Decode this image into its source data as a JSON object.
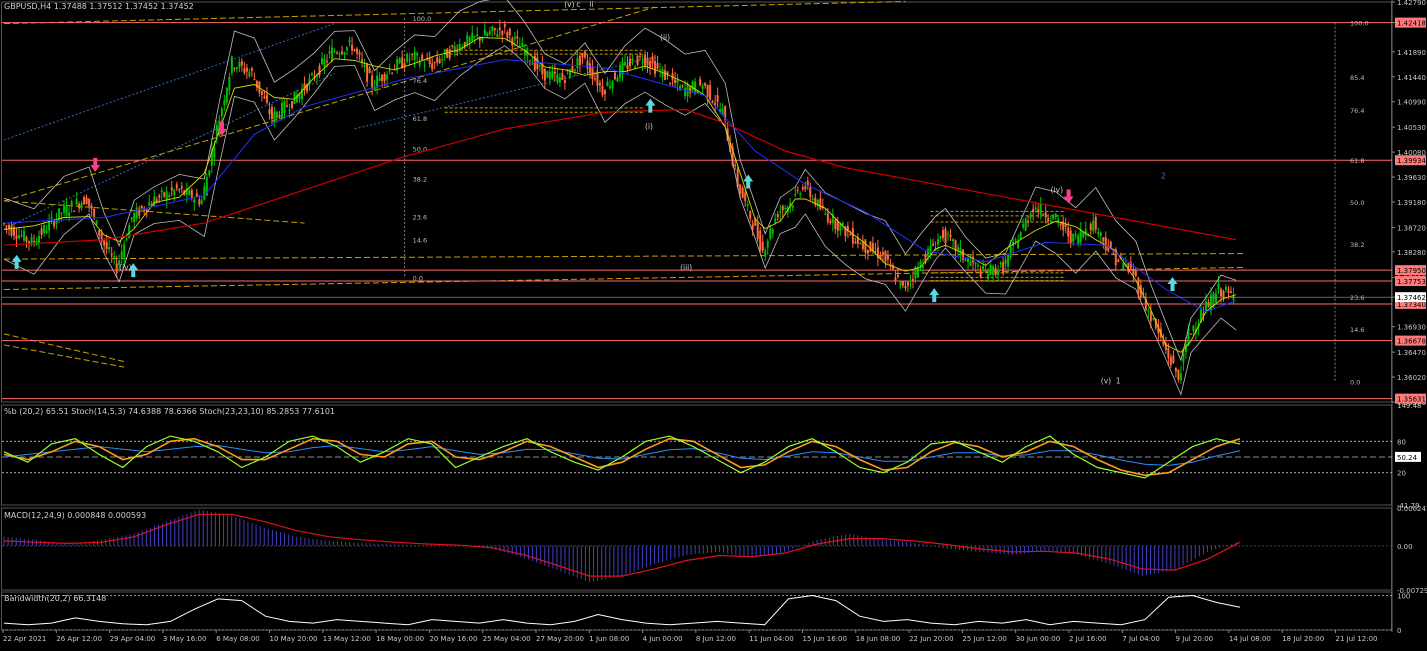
{
  "header": {
    "main": "GBPUSD,H4  1.37488 1.37512 1.37452 1.37452",
    "stoch": "%b (20,2) 65.51  Stoch(14,5,3) 74.6388 78.6366  Stoch(23,23,10) 85.2853 77.6101",
    "macd": "MACD(12,24,9) 0.000848 0.000593",
    "bandwidth": "Bandwidth(20,2) 66.3148"
  },
  "colors": {
    "background": "#000000",
    "bull_candle": "#00c000",
    "bear_candle": "#ff6a3c",
    "resistance_line": "#ff6b6b",
    "fib_dashed": "#c8a000",
    "ma_200": "#d00000",
    "ma_blue": "#2030ff",
    "ma_yellow": "#d8d800",
    "bollinger": "#c0c0c0",
    "stoch_main": "#9aff2a",
    "stoch_signal": "#ff9a1a",
    "stoch_slow": "#2a8cff",
    "macd_hist": "#4040c0",
    "macd_signal": "#e01020",
    "bandwidth": "#ffffff",
    "price_tag": "#ff7a7a",
    "bid_tag": "#ffffff",
    "up_arrow": "#5ad8e0",
    "down_arrow": "#ff3d8b"
  },
  "chart_data": {
    "type": "candlestick",
    "symbol": "GBPUSD",
    "timeframe": "H4",
    "ohlc_header": {
      "open": 1.37488,
      "high": 1.37512,
      "low": 1.37452,
      "close": 1.37452
    },
    "ylim": [
      1.3557,
      1.4279
    ],
    "price_ticks": [
      "1.42790",
      "1.42418",
      "1.41890",
      "1.41440",
      "1.40990",
      "1.40530",
      "1.40080",
      "1.39630",
      "1.39180",
      "1.38720",
      "1.38280",
      "1.37820",
      "1.37462",
      "1.36930",
      "1.36470",
      "1.36020",
      "1.35570"
    ],
    "price_ticks_values": [
      1.4279,
      1.42418,
      1.4189,
      1.4144,
      1.4099,
      1.4053,
      1.4008,
      1.3963,
      1.3918,
      1.3872,
      1.3828,
      1.3782,
      1.37462,
      1.3693,
      1.3647,
      1.3602,
      1.3557
    ],
    "price_tags": [
      {
        "label": "1.42418",
        "value": 1.42418
      },
      {
        "label": "1.39934",
        "value": 1.39934
      },
      {
        "label": "1.37950",
        "value": 1.3795
      },
      {
        "label": "1.37753",
        "value": 1.37753
      },
      {
        "label": "1.37340",
        "value": 1.3734
      },
      {
        "label": "1.36678",
        "value": 1.36678
      },
      {
        "label": "1.35631",
        "value": 1.35631
      }
    ],
    "bid_tag": {
      "label": "1.37462",
      "value": 1.37462
    },
    "resistance_lines": [
      1.42418,
      1.39934,
      1.3795,
      1.37753,
      1.3734,
      1.36678,
      1.35631
    ],
    "fib_right": [
      {
        "label": "100.0",
        "value": 1.42418
      },
      {
        "label": "85.4",
        "value": 1.4144
      },
      {
        "label": "76.4",
        "value": 1.4084
      },
      {
        "label": "61.8",
        "value": 1.39934
      },
      {
        "label": "50.0",
        "value": 1.3918
      },
      {
        "label": "38.2",
        "value": 1.3842
      },
      {
        "label": "23.6",
        "value": 1.37462
      },
      {
        "label": "14.6",
        "value": 1.3689
      },
      {
        "label": "0.0",
        "value": 1.3594
      }
    ],
    "fib_left": [
      {
        "label": "100.0",
        "value": 1.425
      },
      {
        "label": "76.4",
        "value": 1.4138
      },
      {
        "label": "61.8",
        "value": 1.407
      },
      {
        "label": "50.0",
        "value": 1.4015
      },
      {
        "label": "38.2",
        "value": 1.396
      },
      {
        "label": "23.6",
        "value": 1.3892
      },
      {
        "label": "14.6",
        "value": 1.385
      },
      {
        "label": "0.0",
        "value": 1.3782
      }
    ],
    "wave_labels": [
      {
        "text": "(v)",
        "x": 1.5
      },
      {
        "text": "c",
        "x": 1.62
      },
      {
        "text": "ii",
        "x": 1.75
      },
      {
        "text": "(ii)",
        "x": 3.3
      },
      {
        "text": "(i)",
        "x": 1.6
      },
      {
        "text": "(iii)",
        "x": 5.5
      },
      {
        "text": "(iv)",
        "x": 0.85
      },
      {
        "text": "(iv)",
        "x": 8.6
      },
      {
        "text": "(v)",
        "x": 9.8
      },
      {
        "text": "1",
        "x": 9.95
      },
      {
        "text": "2",
        "x": 11.55
      }
    ],
    "x_labels": [
      "22 Apr 2021",
      "26 Apr 12:00",
      "29 Apr 04:00",
      "3 May 16:00",
      "6 May 08:00",
      "10 May 20:00",
      "13 May 12:00",
      "18 May 00:00",
      "20 May 16:00",
      "25 May 04:00",
      "27 May 20:00",
      "1 Jun 08:00",
      "4 Jun 00:00",
      "8 Jun 12:00",
      "11 Jun 04:00",
      "15 Jun 16:00",
      "18 Jun 08:00",
      "22 Jun 20:00",
      "25 Jun 12:00",
      "30 Jun 00:00",
      "2 Jul 16:00",
      "7 Jul 04:00",
      "9 Jul 20:00",
      "14 Jul 08:00",
      "18 Jul 20:00",
      "21 Jul 12:00"
    ],
    "close_path": [
      [
        0,
        1.388
      ],
      [
        0.3,
        1.3845
      ],
      [
        0.6,
        1.39
      ],
      [
        0.85,
        1.3925
      ],
      [
        1.0,
        1.385
      ],
      [
        1.15,
        1.38
      ],
      [
        1.3,
        1.389
      ],
      [
        1.5,
        1.392
      ],
      [
        1.75,
        1.394
      ],
      [
        2.0,
        1.392
      ],
      [
        2.15,
        1.405
      ],
      [
        2.3,
        1.417
      ],
      [
        2.5,
        1.415
      ],
      [
        2.7,
        1.407
      ],
      [
        2.9,
        1.41
      ],
      [
        3.1,
        1.414
      ],
      [
        3.3,
        1.419
      ],
      [
        3.5,
        1.42
      ],
      [
        3.7,
        1.413
      ],
      [
        3.9,
        1.416
      ],
      [
        4.1,
        1.418
      ],
      [
        4.3,
        1.4165
      ],
      [
        4.55,
        1.42
      ],
      [
        4.75,
        1.4215
      ],
      [
        5.0,
        1.423
      ],
      [
        5.2,
        1.4195
      ],
      [
        5.4,
        1.415
      ],
      [
        5.6,
        1.414
      ],
      [
        5.8,
        1.418
      ],
      [
        6.0,
        1.412
      ],
      [
        6.2,
        1.416
      ],
      [
        6.4,
        1.418
      ],
      [
        6.6,
        1.415
      ],
      [
        6.8,
        1.412
      ],
      [
        7.0,
        1.413
      ],
      [
        7.2,
        1.408
      ],
      [
        7.35,
        1.395
      ],
      [
        7.5,
        1.388
      ],
      [
        7.6,
        1.383
      ],
      [
        7.75,
        1.39
      ],
      [
        7.9,
        1.392
      ],
      [
        8.0,
        1.395
      ],
      [
        8.2,
        1.39
      ],
      [
        8.4,
        1.387
      ],
      [
        8.6,
        1.384
      ],
      [
        8.8,
        1.382
      ],
      [
        9.0,
        1.376
      ],
      [
        9.15,
        1.38
      ],
      [
        9.3,
        1.384
      ],
      [
        9.4,
        1.386
      ],
      [
        9.6,
        1.382
      ],
      [
        9.8,
        1.379
      ],
      [
        10.0,
        1.38
      ],
      [
        10.3,
        1.391
      ],
      [
        10.5,
        1.389
      ],
      [
        10.7,
        1.385
      ],
      [
        10.9,
        1.388
      ],
      [
        11.1,
        1.382
      ],
      [
        11.3,
        1.379
      ],
      [
        11.45,
        1.372
      ],
      [
        11.6,
        1.366
      ],
      [
        11.75,
        1.36
      ],
      [
        11.85,
        1.368
      ],
      [
        12.0,
        1.372
      ],
      [
        12.15,
        1.376
      ],
      [
        12.3,
        1.3746
      ]
    ],
    "ma200_path": [
      [
        0,
        1.384
      ],
      [
        1.0,
        1.385
      ],
      [
        2.0,
        1.388
      ],
      [
        3.0,
        1.394
      ],
      [
        4.0,
        1.4
      ],
      [
        5.0,
        1.405
      ],
      [
        6.0,
        1.408
      ],
      [
        6.8,
        1.4085
      ],
      [
        7.2,
        1.406
      ],
      [
        7.8,
        1.401
      ],
      [
        8.4,
        1.398
      ],
      [
        9.0,
        1.396
      ],
      [
        9.6,
        1.394
      ],
      [
        10.2,
        1.392
      ],
      [
        10.8,
        1.39
      ],
      [
        11.4,
        1.388
      ],
      [
        12.3,
        1.385
      ]
    ],
    "ma_blue_path": [
      [
        0,
        1.388
      ],
      [
        1.0,
        1.389
      ],
      [
        2.0,
        1.393
      ],
      [
        2.5,
        1.404
      ],
      [
        3.0,
        1.409
      ],
      [
        4.0,
        1.414
      ],
      [
        5.0,
        1.4175
      ],
      [
        6.0,
        1.416
      ],
      [
        7.0,
        1.411
      ],
      [
        7.5,
        1.401
      ],
      [
        8.0,
        1.395
      ],
      [
        8.6,
        1.39
      ],
      [
        9.2,
        1.383
      ],
      [
        9.8,
        1.381
      ],
      [
        10.4,
        1.3845
      ],
      [
        11.0,
        1.384
      ],
      [
        11.6,
        1.376
      ],
      [
        12.0,
        1.372
      ],
      [
        12.3,
        1.374
      ]
    ],
    "stoch_ylim": [
      -41.79,
      149.48
    ],
    "stoch_levels": [
      80,
      50,
      20
    ],
    "stoch_tick_labels": [
      "149.48",
      "50.24",
      "-41.79"
    ],
    "stoch_level_labels": [
      "80",
      "20"
    ],
    "stoch_main": [
      60,
      40,
      75,
      85,
      55,
      30,
      70,
      90,
      80,
      60,
      30,
      50,
      80,
      90,
      70,
      40,
      60,
      85,
      75,
      30,
      50,
      70,
      85,
      60,
      40,
      25,
      50,
      80,
      90,
      70,
      45,
      20,
      40,
      70,
      85,
      60,
      30,
      20,
      40,
      75,
      80,
      60,
      40,
      70,
      90,
      55,
      30,
      20,
      10,
      40,
      70,
      85,
      74.6
    ],
    "stoch_signal": [
      55,
      45,
      60,
      80,
      70,
      45,
      55,
      80,
      85,
      70,
      45,
      45,
      65,
      85,
      80,
      55,
      50,
      75,
      80,
      50,
      45,
      60,
      80,
      70,
      50,
      30,
      40,
      65,
      85,
      80,
      55,
      30,
      35,
      60,
      80,
      70,
      45,
      25,
      30,
      60,
      78,
      70,
      50,
      60,
      80,
      70,
      45,
      25,
      15,
      20,
      45,
      70,
      85
    ],
    "stoch_slow": [
      50,
      55,
      60,
      65,
      70,
      65,
      60,
      65,
      70,
      72,
      65,
      58,
      60,
      68,
      72,
      66,
      60,
      64,
      70,
      62,
      55,
      58,
      65,
      64,
      56,
      48,
      46,
      55,
      64,
      66,
      58,
      48,
      45,
      52,
      60,
      58,
      50,
      42,
      42,
      50,
      58,
      58,
      52,
      54,
      62,
      62,
      54,
      44,
      36,
      34,
      40,
      52,
      62
    ],
    "macd_ylim": [
      -0.007292,
      0.006247
    ],
    "macd_ticks": [
      "0.006247",
      "0.00",
      "-0.007292"
    ],
    "macd_hist": [
      0.0015,
      0.001,
      0.0002,
      0.001,
      0.002,
      0.004,
      0.006,
      0.005,
      0.003,
      0.0015,
      0.0008,
      0.0005,
      0.0002,
      0.0001,
      0.0,
      -0.0005,
      -0.002,
      -0.004,
      -0.006,
      -0.005,
      -0.003,
      -0.0015,
      -0.001,
      -0.002,
      -0.001,
      0.001,
      0.002,
      0.001,
      0.0005,
      -0.0005,
      -0.001,
      -0.0015,
      -0.0008,
      -0.0015,
      -0.003,
      -0.005,
      -0.004,
      -0.001,
      0.0008
    ],
    "macd_signal": [
      0.0008,
      0.0006,
      0.0004,
      0.0006,
      0.0015,
      0.0035,
      0.0052,
      0.0052,
      0.004,
      0.0025,
      0.0015,
      0.001,
      0.0006,
      0.0003,
      0.0001,
      -0.0003,
      -0.0015,
      -0.0032,
      -0.005,
      -0.005,
      -0.0038,
      -0.0024,
      -0.0016,
      -0.0018,
      -0.0012,
      0.0003,
      0.0012,
      0.0012,
      0.0008,
      0.0002,
      -0.0005,
      -0.001,
      -0.0009,
      -0.0012,
      -0.0022,
      -0.0038,
      -0.004,
      -0.0022,
      0.0006
    ],
    "bw_ylim": [
      0,
      110
    ],
    "bw_ticks": [
      "100",
      "0"
    ],
    "bw_values": [
      20,
      15,
      20,
      35,
      25,
      18,
      15,
      25,
      60,
      90,
      85,
      40,
      25,
      20,
      30,
      25,
      20,
      15,
      30,
      25,
      20,
      30,
      20,
      15,
      25,
      45,
      30,
      20,
      15,
      20,
      25,
      20,
      15,
      90,
      100,
      85,
      40,
      25,
      30,
      20,
      15,
      25,
      20,
      30,
      15,
      25,
      20,
      15,
      30,
      95,
      100,
      80,
      66
    ]
  },
  "arrows": {
    "up": [
      [
        0.25,
        1.381
      ],
      [
        2.55,
        1.3795
      ],
      [
        12.75,
        1.4092
      ],
      [
        14.68,
        1.3955
      ],
      [
        18.35,
        1.375
      ],
      [
        23.05,
        1.377
      ]
    ],
    "down": [
      [
        1.8,
        1.3985
      ],
      [
        4.3,
        1.405
      ],
      [
        21.0,
        1.3928
      ]
    ]
  }
}
